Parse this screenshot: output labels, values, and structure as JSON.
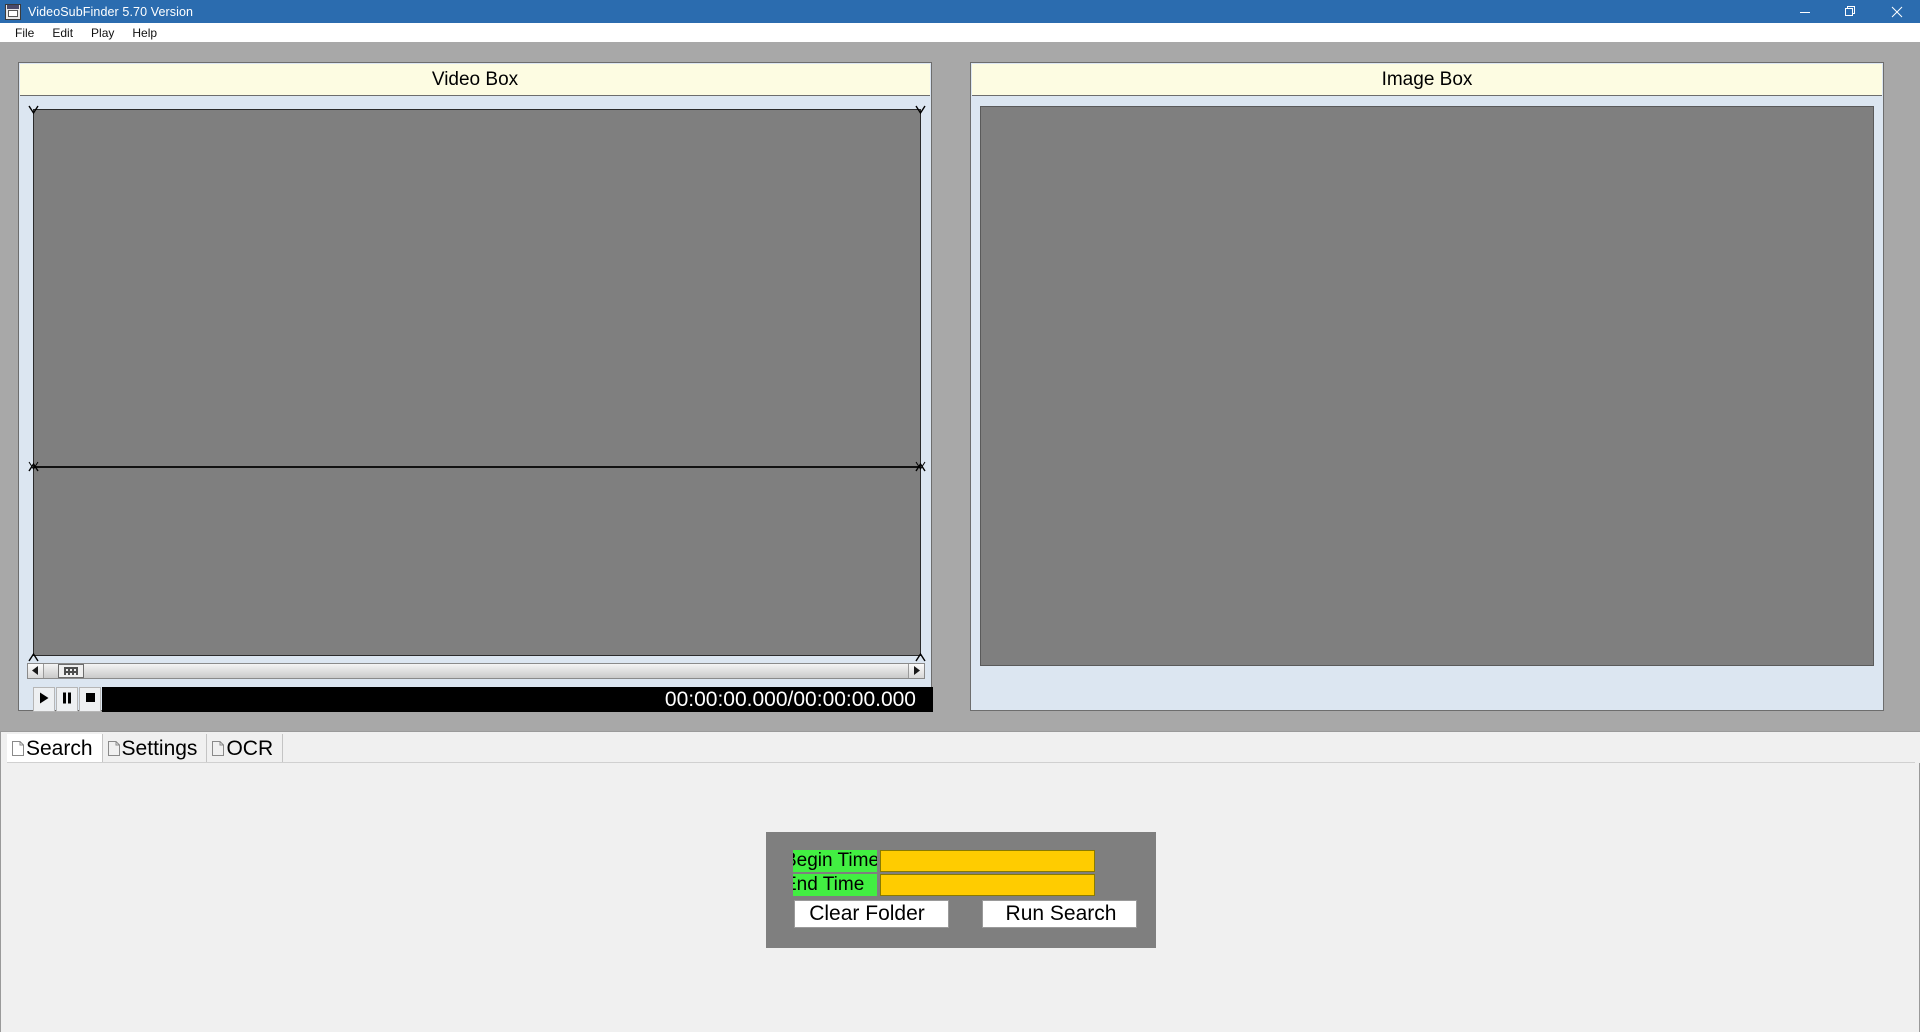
{
  "window": {
    "title": "VideoSubFinder 5.70 Version",
    "icon": "app-icon",
    "controls": [
      {
        "name": "minimize",
        "glyph": "minimize-icon"
      },
      {
        "name": "restore",
        "glyph": "restore-icon"
      },
      {
        "name": "close",
        "glyph": "close-icon"
      }
    ]
  },
  "menubar": {
    "items": [
      {
        "label": "File"
      },
      {
        "label": "Edit"
      },
      {
        "label": "Play"
      },
      {
        "label": "Help"
      }
    ]
  },
  "video_panel": {
    "title": "Video Box",
    "canvas_color": "#7f7f7f",
    "header_color": "#fdfce2",
    "panel_color": "#dce6f1",
    "scrollbar": {
      "left_arrow": "triangle-left-icon",
      "right_arrow": "triangle-right-icon",
      "thumb": "slider-thumb"
    },
    "controls": {
      "play": "play-icon",
      "pause": "pause-icon",
      "stop": "stop-icon",
      "time": "00:00:00.000/00:00:00.000"
    }
  },
  "image_panel": {
    "title": "Image Box",
    "canvas_color": "#7f7f7f",
    "header_color": "#fdfce2",
    "panel_color": "#dce6f1"
  },
  "tabs": [
    {
      "label": "Search",
      "icon": "page-icon",
      "active": true
    },
    {
      "label": "Settings",
      "icon": "page-icon",
      "active": false
    },
    {
      "label": "OCR",
      "icon": "page-icon",
      "active": false
    }
  ],
  "search_panel": {
    "group_color": "#7f7f7f",
    "label_color": "#42ef42",
    "input_color": "#ffcc00",
    "fields": [
      {
        "label": "Begin Time",
        "label_clipped": "egin Time",
        "value": "",
        "placeholder": ""
      },
      {
        "label": "End Time",
        "label_clipped": "End Time",
        "value": "",
        "placeholder": ""
      }
    ],
    "buttons": [
      {
        "label": "Clear Folder",
        "label_clipped": "lear Folder"
      },
      {
        "label": "Run Search",
        "label_clipped": "Run Search"
      }
    ]
  }
}
